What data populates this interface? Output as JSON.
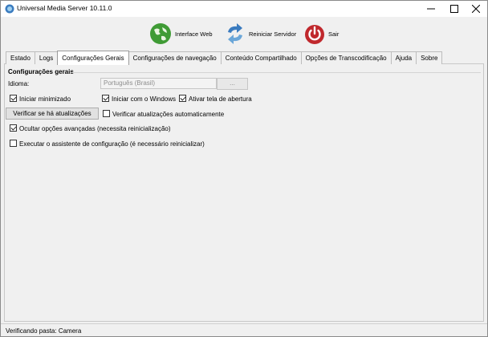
{
  "window": {
    "title": "Universal Media Server 10.11.0",
    "controls": {
      "minimize": "—",
      "maximize": "☐",
      "close": "✕"
    }
  },
  "toolbar": {
    "web_label": "Interface Web",
    "restart_label": "Reiniciar Servidor",
    "exit_label": "Sair"
  },
  "tabs": [
    {
      "label": "Estado"
    },
    {
      "label": "Logs"
    },
    {
      "label": "Configurações Gerais",
      "active": true
    },
    {
      "label": "Configurações de navegação"
    },
    {
      "label": "Conteúdo Compartilhado"
    },
    {
      "label": "Opções de Transcodificação"
    },
    {
      "label": "Ajuda"
    },
    {
      "label": "Sobre"
    }
  ],
  "general": {
    "section_title": "Configurações gerais",
    "language_label": "Idioma:",
    "language_value": "Português (Brasil)",
    "dots_button": "...",
    "start_minimized": {
      "label": "Iniciar minimizado",
      "checked": true
    },
    "start_with_windows": {
      "label": "Iniciar com o Windows",
      "checked": true
    },
    "show_splash": {
      "label": "Ativar tela de abertura",
      "checked": true
    },
    "check_updates_button": "Verificar se há atualizações",
    "auto_check_updates": {
      "label": "Verificar atualizações automaticamente",
      "checked": false
    },
    "hide_advanced": {
      "label": "Ocultar opções avançadas (necessita reinicialização)",
      "checked": true
    },
    "run_wizard": {
      "label": "Executar o assistente de configuração (é necessário reinicializar)",
      "checked": false
    }
  },
  "status": {
    "text": "Verificando pasta: Camera"
  },
  "colors": {
    "accent_red": "#c0282d",
    "globe_green": "#3f9b35",
    "restart_blue": "#3a7bbf"
  }
}
